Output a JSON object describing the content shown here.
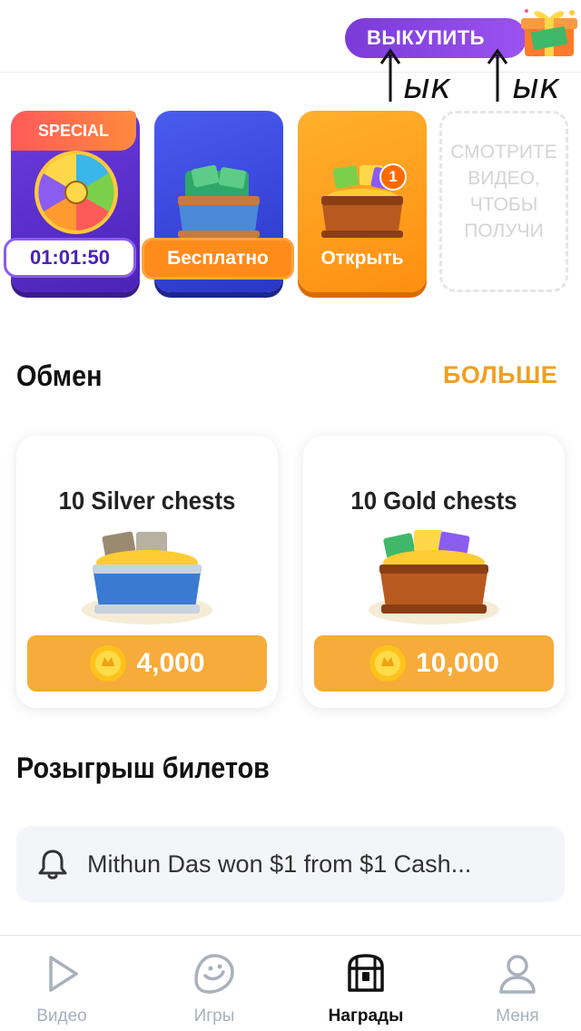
{
  "header": {
    "buy_label": "ВЫКУПИТЬ",
    "handwriting_text": "↑ык↑ык"
  },
  "reward_cards": {
    "special": {
      "badge": "SPECIAL",
      "timer": "01:01:50"
    },
    "free": {
      "label": "Бесплатно"
    },
    "open": {
      "label": "Открыть",
      "count": "1"
    },
    "video": {
      "text": "СМОТРИТЕ ВИДЕО, ЧТОБЫ ПОЛУЧИ"
    }
  },
  "exchange": {
    "title": "Обмен",
    "more_label": "БОЛЬШЕ",
    "offers": [
      {
        "title": "10 Silver chests",
        "price": "4,000"
      },
      {
        "title": "10 Gold chests",
        "price": "10,000"
      }
    ]
  },
  "raffle": {
    "title": "Розыгрыш билетов",
    "notice": "Mithun Das won $1 from $1 Cash..."
  },
  "bottom_nav": {
    "items": [
      {
        "label": "Видео",
        "icon": "play-icon",
        "active": false
      },
      {
        "label": "Игры",
        "icon": "games-icon",
        "active": false
      },
      {
        "label": "Награды",
        "icon": "chest-icon",
        "active": true
      },
      {
        "label": "Меня",
        "icon": "user-icon",
        "active": false
      }
    ]
  },
  "colors": {
    "accent_orange": "#f7ab3a",
    "more_link": "#f0a020",
    "buy_purple": "#8a45e6",
    "nav_inactive": "#aab0bc"
  }
}
